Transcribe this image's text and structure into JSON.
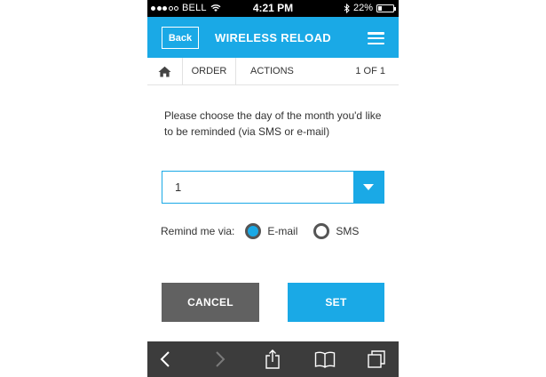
{
  "status_bar": {
    "carrier": "BELL",
    "time": "4:21 PM",
    "battery": "22%",
    "signal_bars_filled": 3,
    "signal_bars_total": 5,
    "battery_level": 0.22
  },
  "header": {
    "back_label": "Back",
    "title": "WIRELESS RELOAD",
    "menu_icon": "hamburger-icon"
  },
  "breadcrumb": {
    "home_icon": "home-icon",
    "order": "ORDER",
    "actions": "ACTIONS",
    "page": "1 OF 1"
  },
  "form": {
    "prompt": "Please choose the day of the month you'd like to be reminded (via SMS or e-mail)",
    "day_select_value": "1",
    "remind_label": "Remind me via:",
    "options": [
      {
        "label": "E-mail",
        "selected": true
      },
      {
        "label": "SMS",
        "selected": false
      }
    ],
    "cancel_label": "CANCEL",
    "set_label": "SET"
  },
  "colors": {
    "accent": "#1aa9e6",
    "cancel": "#616161",
    "toolbar": "#3c3c3c"
  },
  "toolbar": {
    "icons": [
      "back-arrow-icon",
      "forward-arrow-icon",
      "share-icon",
      "bookmarks-icon",
      "tabs-icon"
    ]
  }
}
